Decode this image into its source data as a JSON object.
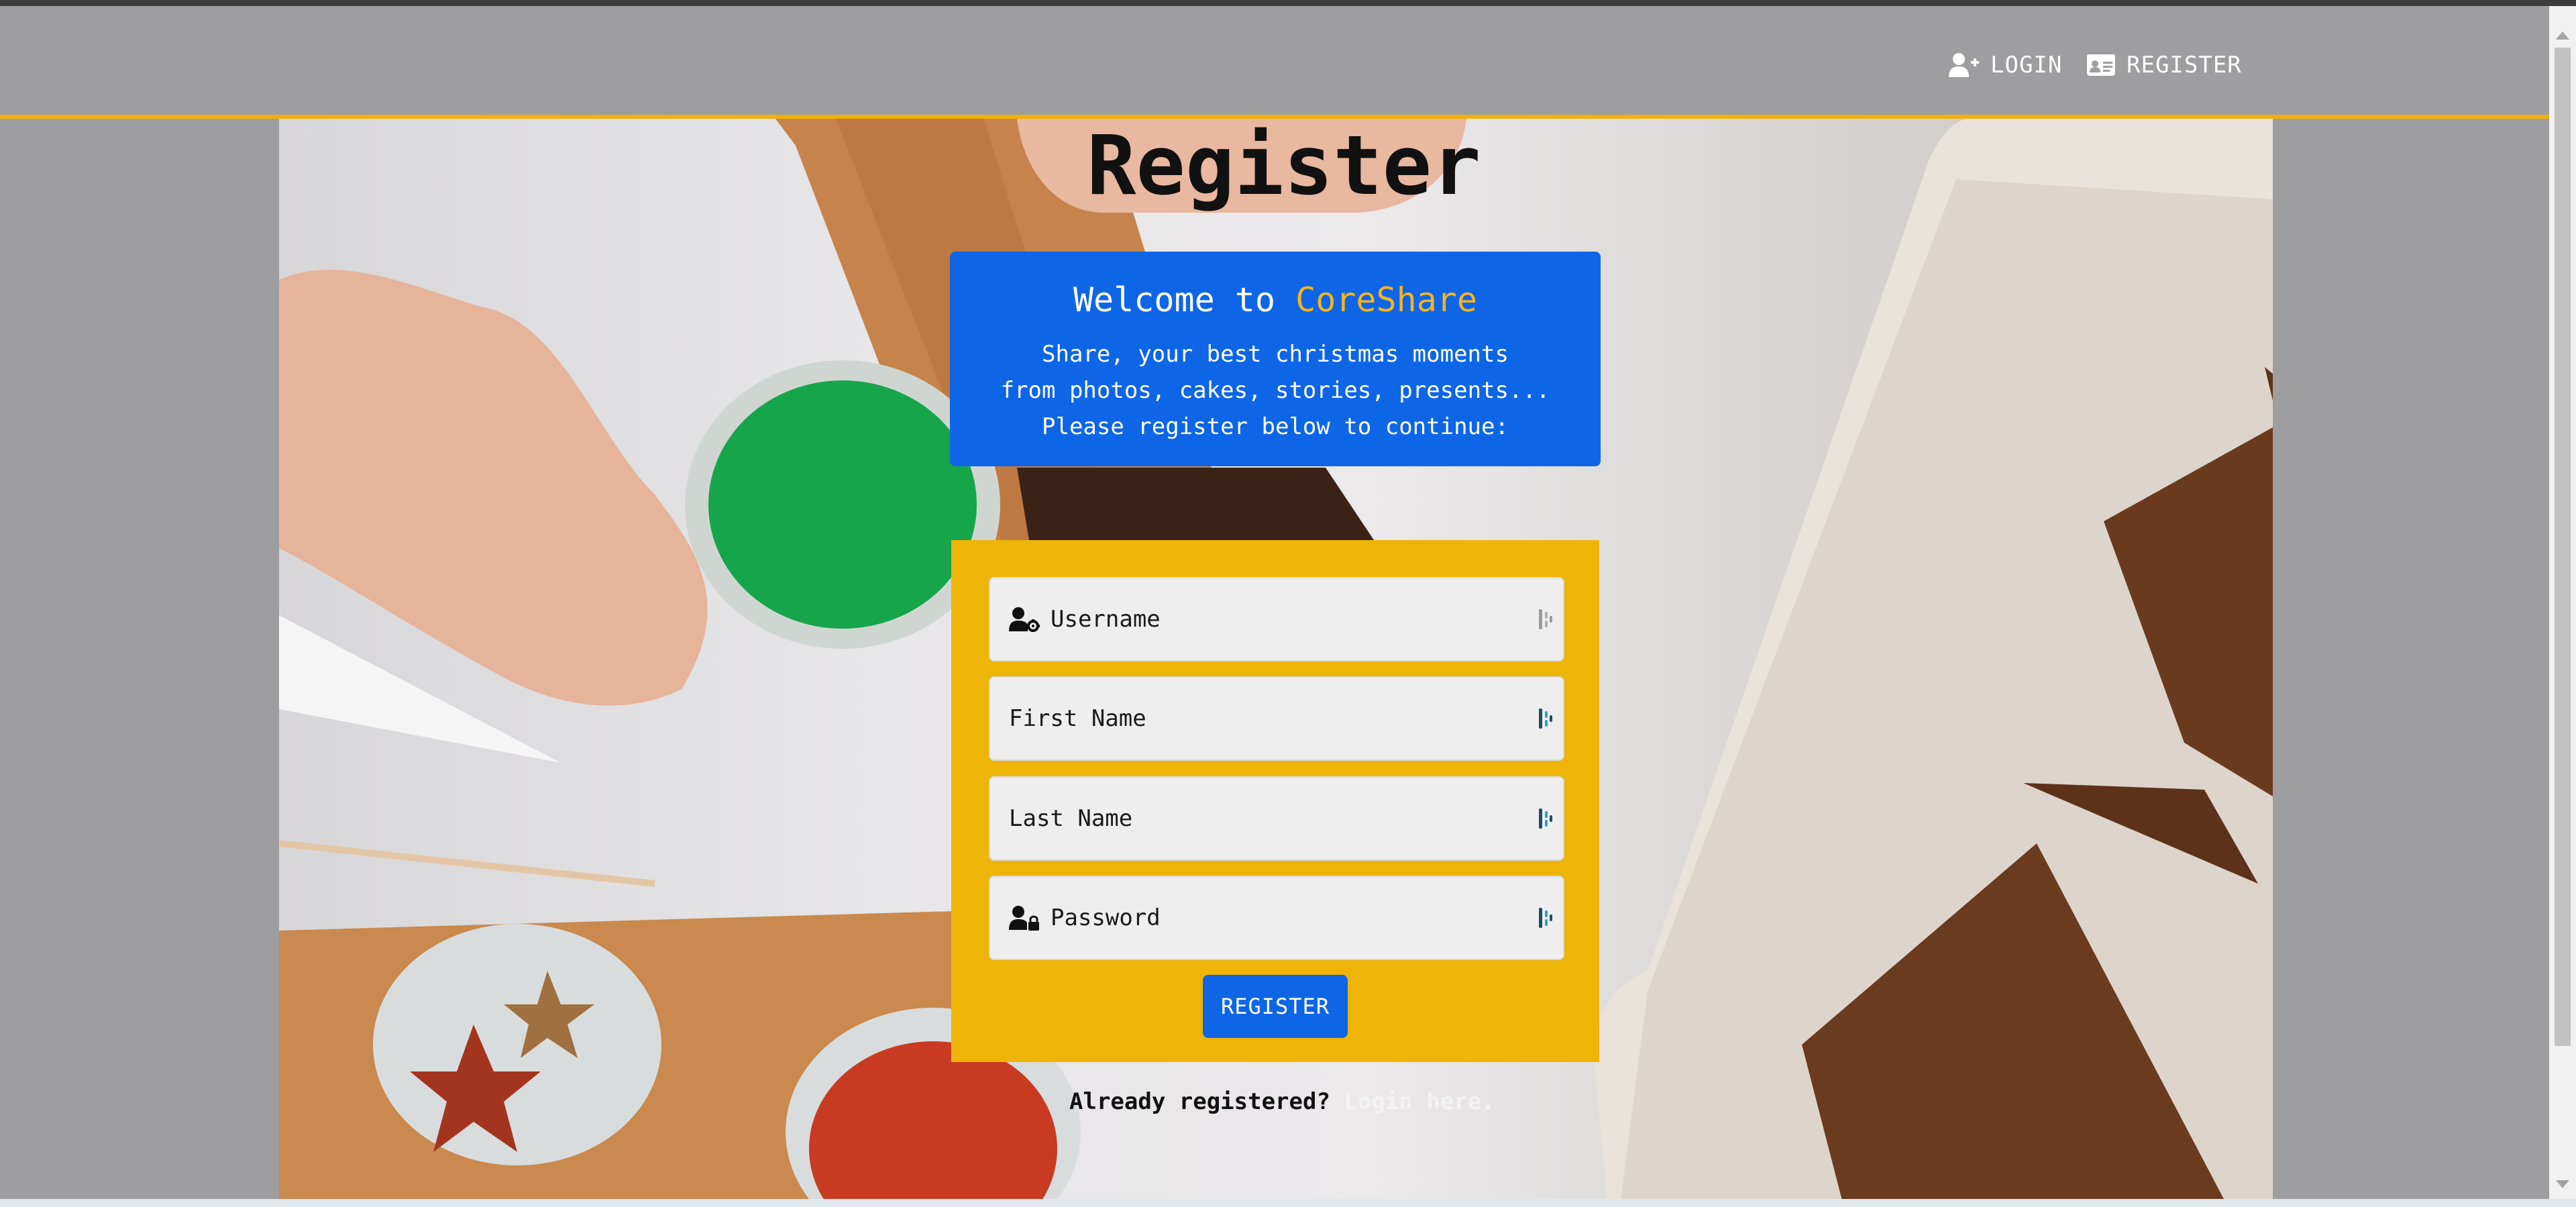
{
  "nav": {
    "login_label": "LOGIN",
    "register_label": "REGISTER"
  },
  "page": {
    "title": "Register"
  },
  "welcome": {
    "heading_prefix": "Welcome to ",
    "brand": "CoreShare",
    "line1": "Share, your best christmas moments",
    "line2": "from photos, cakes, stories, presents...",
    "line3": "Please register below to continue:"
  },
  "form": {
    "username_placeholder": "Username",
    "firstname_placeholder": "First Name",
    "lastname_placeholder": "Last Name",
    "password_placeholder": "Password",
    "submit_label": "REGISTER"
  },
  "footer": {
    "prompt": "Already registered? ",
    "link": "Login here."
  },
  "colors": {
    "accent_yellow": "#eeb408",
    "primary_blue": "#0e66e7",
    "navbar_gray": "#9e9d9f",
    "brand_text": "#f4b31e"
  },
  "icons": {
    "login": "user-plus-icon",
    "register": "id-card-icon",
    "username": "user-gear-icon",
    "password": "user-lock-icon",
    "field_suffix": "password-manager-icon"
  }
}
